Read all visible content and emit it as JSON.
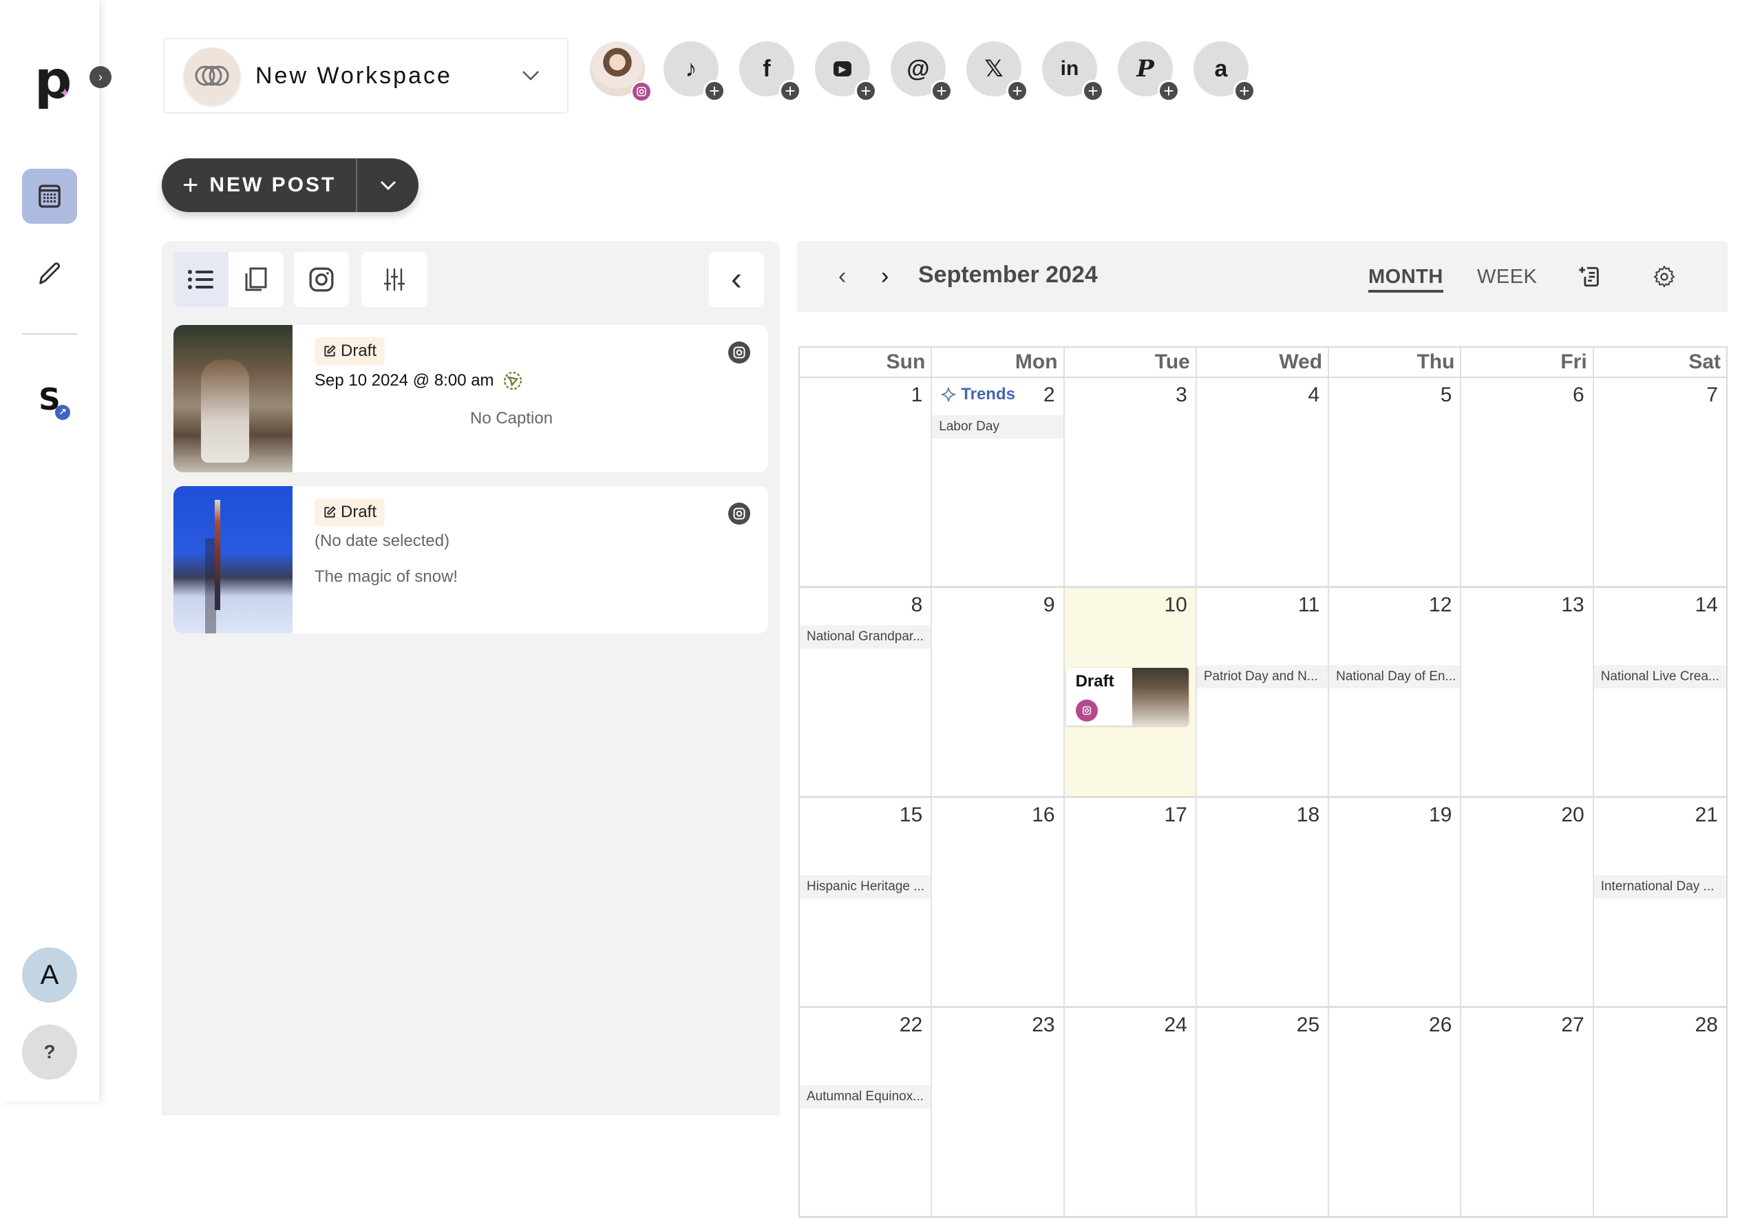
{
  "sidebar": {
    "logo_letter": "p",
    "expand_glyph": "›",
    "items": [
      {
        "name": "calendar",
        "icon": "calendar-icon",
        "active": true
      },
      {
        "name": "compose",
        "icon": "pencil-icon",
        "active": false
      },
      {
        "name": "linked-app",
        "icon": "s-logo-icon",
        "active": false
      }
    ],
    "account_initial": "A",
    "help_label": "?"
  },
  "workspace": {
    "label": "New Workspace",
    "icon": "rings-icon"
  },
  "social_accounts": {
    "connected": {
      "network": "instagram",
      "badge": "instagram-icon"
    },
    "add_networks": [
      {
        "name": "tiktok",
        "glyph": "♪"
      },
      {
        "name": "facebook",
        "glyph": "f"
      },
      {
        "name": "youtube",
        "glyph": "▶"
      },
      {
        "name": "threads",
        "glyph": "@"
      },
      {
        "name": "x",
        "glyph": "𝕏"
      },
      {
        "name": "linkedin",
        "glyph": "in"
      },
      {
        "name": "pinterest",
        "glyph": "P"
      },
      {
        "name": "amazon",
        "glyph": "a"
      }
    ],
    "add_glyph": "+"
  },
  "new_post": {
    "plus": "+",
    "label": "NEW POST"
  },
  "post_list": {
    "toolbar": [
      {
        "name": "list-view",
        "icon": "list-icon",
        "active": true
      },
      {
        "name": "grid-view",
        "icon": "copy-icon",
        "active": false
      },
      {
        "name": "instagram-filter",
        "icon": "instagram-icon",
        "active": false
      },
      {
        "name": "filters",
        "icon": "sliders-icon",
        "active": false
      }
    ],
    "collapse_glyph": "‹",
    "posts": [
      {
        "status": "Draft",
        "date": "Sep 10 2024 @ 8:00 am",
        "caption": "No Caption",
        "network": "instagram",
        "auto_publish": true
      },
      {
        "status": "Draft",
        "date": "(No date selected)",
        "caption": "The magic of snow!",
        "network": "instagram",
        "auto_publish": false
      }
    ]
  },
  "calendar": {
    "title": "September 2024",
    "prev_glyph": "‹",
    "next_glyph": "›",
    "views": [
      {
        "label": "MONTH",
        "active": true
      },
      {
        "label": "WEEK",
        "active": false
      }
    ],
    "weekdays": [
      "Sun",
      "Mon",
      "Tue",
      "Wed",
      "Thu",
      "Fri",
      "Sat"
    ],
    "trends_label": "Trends",
    "today": 10,
    "weeks": [
      [
        {
          "day": "1"
        },
        {
          "day": "2",
          "trends": true,
          "holiday": "Labor Day",
          "holiday_slot": 0
        },
        {
          "day": "3"
        },
        {
          "day": "4"
        },
        {
          "day": "5"
        },
        {
          "day": "6"
        },
        {
          "day": "7"
        }
      ],
      [
        {
          "day": "8",
          "holiday": "National Grandpar...",
          "holiday_slot": 0
        },
        {
          "day": "9"
        },
        {
          "day": "10",
          "today": true,
          "event": {
            "label": "Draft",
            "network": "instagram"
          }
        },
        {
          "day": "11",
          "holiday": "Patriot Day and N...",
          "holiday_slot": 1
        },
        {
          "day": "12",
          "holiday": "National Day of En...",
          "holiday_slot": 1
        },
        {
          "day": "13"
        },
        {
          "day": "14",
          "holiday": "National Live Crea...",
          "holiday_slot": 1
        }
      ],
      [
        {
          "day": "15",
          "holiday": "Hispanic Heritage ...",
          "holiday_slot": 1
        },
        {
          "day": "16"
        },
        {
          "day": "17"
        },
        {
          "day": "18"
        },
        {
          "day": "19"
        },
        {
          "day": "20"
        },
        {
          "day": "21",
          "holiday": "International Day ...",
          "holiday_slot": 1
        }
      ],
      [
        {
          "day": "22",
          "holiday": "Autumnal Equinox...",
          "holiday_slot": 1
        },
        {
          "day": "23"
        },
        {
          "day": "24"
        },
        {
          "day": "25"
        },
        {
          "day": "26"
        },
        {
          "day": "27"
        },
        {
          "day": "28"
        }
      ]
    ]
  },
  "colors": {
    "accent_sidebar_active": "#aebbe0",
    "instagram": "#b34a8d",
    "trends": "#4467b2",
    "today_bg": "#fbf9e4",
    "draft_badge_bg": "#fbf1e4",
    "button_dark": "#3b3b3b"
  }
}
